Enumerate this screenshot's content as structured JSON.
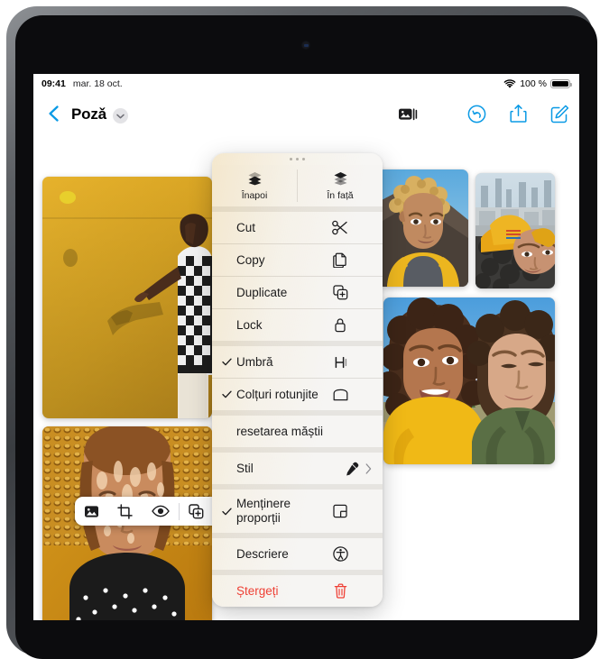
{
  "status_bar": {
    "time": "09:41",
    "date": "mar. 18 oct.",
    "wifi_icon": "wifi-icon",
    "battery_percent": "100 %",
    "battery_icon": "battery-full-icon"
  },
  "nav_bar": {
    "back_icon": "chevron-left-icon",
    "title": "Pozǎ",
    "title_chevron_icon": "chevron-down-icon",
    "media_icon": "insert-media-icon",
    "undo_icon": "undo-icon",
    "share_icon": "share-icon",
    "compose_icon": "compose-icon"
  },
  "image_toolbar": {
    "buttons": [
      {
        "name": "replace-image-button",
        "icon": "photo-icon"
      },
      {
        "name": "crop-button",
        "icon": "crop-icon"
      },
      {
        "name": "preview-button",
        "icon": "eye-icon"
      },
      {
        "name": "duplicate-button",
        "icon": "duplicate-icon"
      },
      {
        "name": "delete-button",
        "icon": "trash-icon"
      }
    ]
  },
  "context_menu": {
    "grabber": "drag-handle",
    "arrange": [
      {
        "label": "Înapoi",
        "icon": "send-backward-icon"
      },
      {
        "label": "În față",
        "icon": "bring-forward-icon"
      }
    ],
    "items": [
      {
        "label": "Cut",
        "icon": "scissors-icon",
        "checked": false,
        "submenu": false,
        "destructive": false
      },
      {
        "label": "Copy",
        "icon": "copy-icon",
        "checked": false,
        "submenu": false,
        "destructive": false
      },
      {
        "label": "Duplicate",
        "icon": "duplicate-icon",
        "checked": false,
        "submenu": false,
        "destructive": false
      },
      {
        "label": "Lock",
        "icon": "lock-icon",
        "checked": false,
        "submenu": false,
        "destructive": false
      },
      {
        "label": "Umbră",
        "icon": "shadow-icon",
        "checked": true,
        "submenu": false,
        "destructive": false
      },
      {
        "label": "Colțuri rotunjite",
        "icon": "rounded-corners-icon",
        "checked": true,
        "submenu": false,
        "destructive": false
      },
      {
        "label": "resetarea măștii",
        "icon": "",
        "checked": false,
        "submenu": false,
        "destructive": false
      },
      {
        "label": "Stil",
        "icon": "eyedropper-icon",
        "checked": false,
        "submenu": true,
        "destructive": false
      },
      {
        "label": "Menținere proporții",
        "icon": "aspect-ratio-icon",
        "checked": true,
        "submenu": false,
        "destructive": false
      },
      {
        "label": "Descriere",
        "icon": "accessibility-icon",
        "checked": false,
        "submenu": false,
        "destructive": false
      },
      {
        "label": "Ștergeți",
        "icon": "trash-icon",
        "checked": false,
        "submenu": false,
        "destructive": true
      }
    ]
  },
  "canvas": {
    "photos": [
      {
        "name": "photo-yellow-wall",
        "description": "Person in checkered shirt tossing a lemon against a yellow wall"
      },
      {
        "name": "photo-hat-portrait",
        "description": "Portrait with dappled light through a straw hat"
      },
      {
        "name": "photo-curly-boy",
        "description": "Boy with curly blond hair in a yellow and gray raglan shirt"
      },
      {
        "name": "photo-yellow-coat",
        "description": "Person in a yellow jacket lying down with a city skyline behind"
      },
      {
        "name": "photo-selfie-pair",
        "description": "Selfie of two young people outdoors with mountains behind"
      }
    ]
  },
  "colors": {
    "accent_blue": "#0a9ae5",
    "destructive_red": "#ef4136",
    "menu_background": "#f6f5f3",
    "menu_divider": "#dedcd8"
  }
}
